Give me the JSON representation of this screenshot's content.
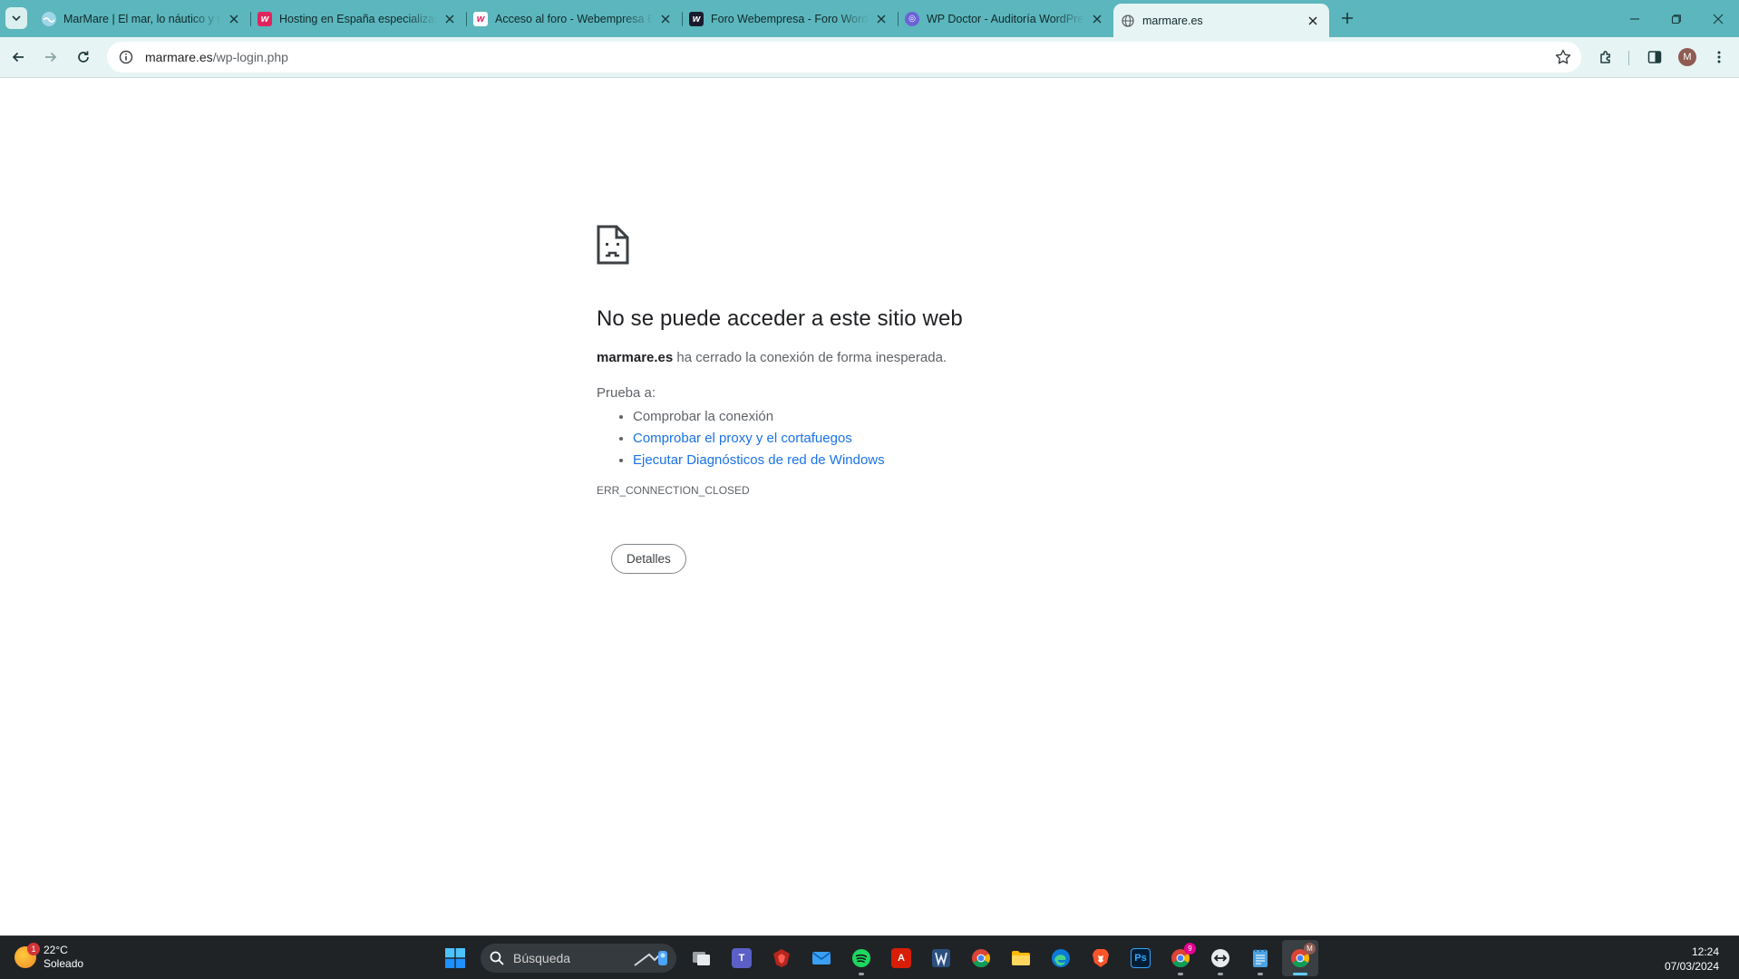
{
  "browser": {
    "tabs": [
      {
        "title": "MarMare | El mar, lo náutico y más",
        "favicon": "marmare",
        "active": false
      },
      {
        "title": "Hosting en España especializado",
        "favicon": "webempresa",
        "active": false
      },
      {
        "title": "Acceso al foro - Webempresa E",
        "favicon": "webempresa",
        "active": false
      },
      {
        "title": "Foro Webempresa - Foro WordPress",
        "favicon": "webempresa-dark",
        "active": false
      },
      {
        "title": "WP Doctor - Auditoría WordPress",
        "favicon": "wpdoctor",
        "active": false
      },
      {
        "title": "marmare.es",
        "favicon": "globe",
        "active": true
      }
    ],
    "url": {
      "host": "marmare.es",
      "path": "/wp-login.php"
    },
    "profile_initial": "M"
  },
  "error_page": {
    "title": "No se puede acceder a este sitio web",
    "host": "marmare.es",
    "description": " ha cerrado la conexión de forma inesperada.",
    "try_label": "Prueba a:",
    "suggestions": [
      {
        "text": "Comprobar la conexión",
        "link": false
      },
      {
        "text": "Comprobar el proxy y el cortafuegos",
        "link": true
      },
      {
        "text": "Ejecutar Diagnósticos de red de Windows",
        "link": true
      }
    ],
    "error_code": "ERR_CONNECTION_CLOSED",
    "details_button": "Detalles"
  },
  "taskbar": {
    "weather": {
      "temp": "22°C",
      "condition": "Soleado",
      "badge": "1"
    },
    "search_placeholder": "Búsqueda",
    "time": "12:24",
    "date": "07/03/2024",
    "chrome_badge": "9",
    "chrome_profile_badge": "M"
  },
  "colors": {
    "tabstrip": "#5cb6bd",
    "toolbar": "#e7f4f4",
    "link": "#1a73e8",
    "taskbar": "#1f2326"
  }
}
